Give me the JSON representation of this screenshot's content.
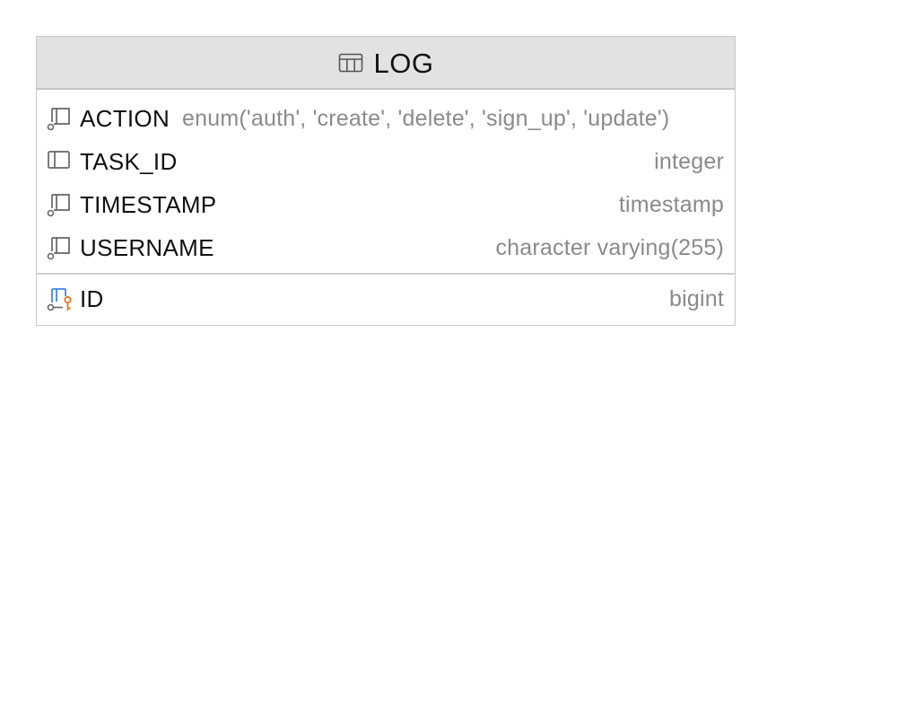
{
  "entity": {
    "title": "LOG",
    "icon": "table-icon",
    "columns": [
      {
        "name": "ACTION",
        "type": "enum('auth', 'create', 'delete', 'sign_up', 'update')",
        "icon": "nullable-column-icon"
      },
      {
        "name": "TASK_ID",
        "type": "integer",
        "icon": "column-icon"
      },
      {
        "name": "TIMESTAMP",
        "type": "timestamp",
        "icon": "nullable-column-icon"
      },
      {
        "name": "USERNAME",
        "type": "character varying(255)",
        "icon": "nullable-column-icon"
      }
    ],
    "keys": [
      {
        "name": "ID",
        "type": "bigint",
        "icon": "primary-key-column-icon"
      }
    ]
  },
  "colors": {
    "header_bg": "#e2e2e2",
    "border": "#c9c9c9",
    "type_text": "#8a8a8a",
    "key_accent": "#e07a1f",
    "key_column_blue": "#3d7ee0"
  }
}
